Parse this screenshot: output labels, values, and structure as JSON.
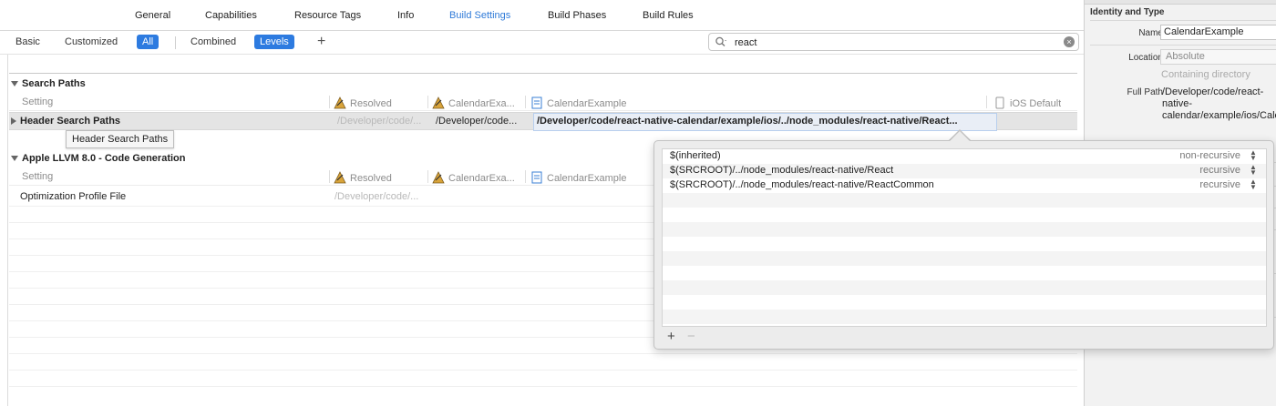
{
  "tabs": [
    "General",
    "Capabilities",
    "Resource Tags",
    "Info",
    "Build Settings",
    "Build Phases",
    "Build Rules"
  ],
  "active_tab": "Build Settings",
  "filter": {
    "scope": [
      "Basic",
      "Customized",
      "All"
    ],
    "scope_selected": "All",
    "view": [
      "Combined",
      "Levels"
    ],
    "view_selected": "Levels",
    "add_symbol": "+"
  },
  "search": {
    "value": "react",
    "clear_symbol": "×"
  },
  "sections": {
    "search_paths": {
      "title": "Search Paths",
      "header": {
        "setting": "Setting",
        "resolved": "Resolved",
        "target": "CalendarExa...",
        "project": "CalendarExample",
        "default": "iOS Default"
      },
      "row": {
        "name": "Header Search Paths",
        "resolved": "/Developer/code/...",
        "target": "/Developer/code...",
        "project": "/Developer/code/react-native-calendar/example/ios/../node_modules/react-native/React..."
      }
    },
    "llvm": {
      "title": "Apple LLVM 8.0 - Code Generation",
      "header": {
        "setting": "Setting",
        "resolved": "Resolved",
        "target": "CalendarExa...",
        "project": "CalendarExample"
      },
      "row": {
        "name": "Optimization Profile File",
        "resolved": "/Developer/code/..."
      }
    }
  },
  "tooltip": "Header Search Paths",
  "popover": {
    "rows": [
      {
        "path": "$(inherited)",
        "type": "non-recursive"
      },
      {
        "path": "$(SRCROOT)/../node_modules/react-native/React",
        "type": "recursive"
      },
      {
        "path": "$(SRCROOT)/../node_modules/react-native/ReactCommon",
        "type": "recursive"
      }
    ],
    "add_symbol": "+",
    "remove_symbol": "−"
  },
  "inspector": {
    "title": "Identity and Type",
    "name_label": "Name",
    "name_value": "CalendarExample",
    "location_label": "Location",
    "location_value": "Absolute",
    "location_sub": "Containing directory",
    "fullpath_label": "Full Path",
    "fullpath_value": "/Developer/code/react-native-calendar/example/ios/CalendarExample.xcodeproj"
  },
  "colors": {
    "accent": "#2d7be0",
    "selected_row": "#e4e4e4",
    "popover_bg": "#ececec"
  },
  "icons": [
    "search-icon",
    "target-icon",
    "project-file-icon",
    "disclosure-triangle-icon",
    "stepper-icon"
  ]
}
